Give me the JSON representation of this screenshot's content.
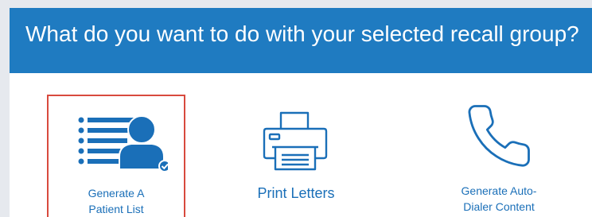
{
  "dialog": {
    "title": "What do you want to do with your selected recall group?",
    "colors": {
      "header": "#1f7bc1",
      "accent": "#1a6fb8",
      "selected_border": "#d84a3e"
    },
    "options": [
      {
        "line1": "Generate A",
        "line2": "Patient List",
        "icon": "patient-list-icon",
        "selected": true
      },
      {
        "label": "Print Letters",
        "icon": "printer-icon",
        "selected": false
      },
      {
        "line1": "Generate Auto-",
        "line2": "Dialer Content",
        "icon": "phone-icon",
        "selected": false
      }
    ]
  }
}
